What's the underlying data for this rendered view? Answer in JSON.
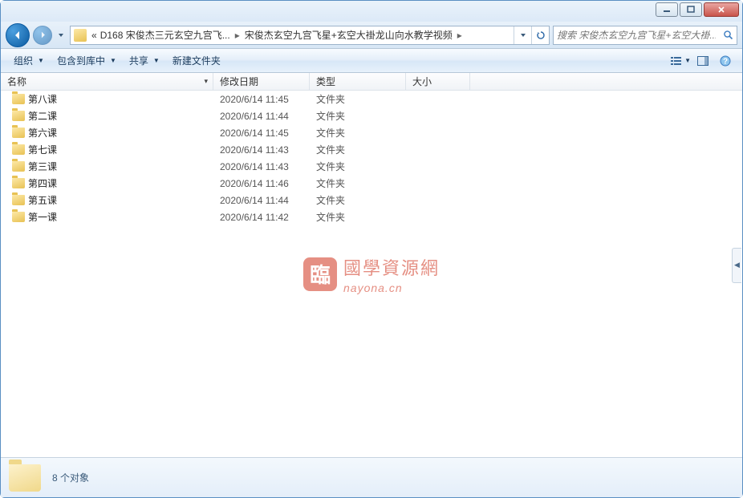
{
  "breadcrumb": {
    "prefix": "«",
    "seg1": "D168 宋俊杰三元玄空九宫飞...",
    "seg2": "宋俊杰玄空九宫飞星+玄空大褂龙山向水教学视频"
  },
  "search": {
    "placeholder": "搜索 宋俊杰玄空九宫飞星+玄空大褂..."
  },
  "toolbar": {
    "organize": "组织",
    "include": "包含到库中",
    "share": "共享",
    "newfolder": "新建文件夹"
  },
  "columns": {
    "name": "名称",
    "date": "修改日期",
    "type": "类型",
    "size": "大小"
  },
  "files": [
    {
      "name": "第八课",
      "date": "2020/6/14 11:45",
      "type": "文件夹"
    },
    {
      "name": "第二课",
      "date": "2020/6/14 11:44",
      "type": "文件夹"
    },
    {
      "name": "第六课",
      "date": "2020/6/14 11:45",
      "type": "文件夹"
    },
    {
      "name": "第七课",
      "date": "2020/6/14 11:43",
      "type": "文件夹"
    },
    {
      "name": "第三课",
      "date": "2020/6/14 11:43",
      "type": "文件夹"
    },
    {
      "name": "第四课",
      "date": "2020/6/14 11:46",
      "type": "文件夹"
    },
    {
      "name": "第五课",
      "date": "2020/6/14 11:44",
      "type": "文件夹"
    },
    {
      "name": "第一课",
      "date": "2020/6/14 11:42",
      "type": "文件夹"
    }
  ],
  "watermark": {
    "logo": "臨",
    "text": "國學資源網",
    "sub": "nayona.cn"
  },
  "status": {
    "text": "8 个对象"
  }
}
